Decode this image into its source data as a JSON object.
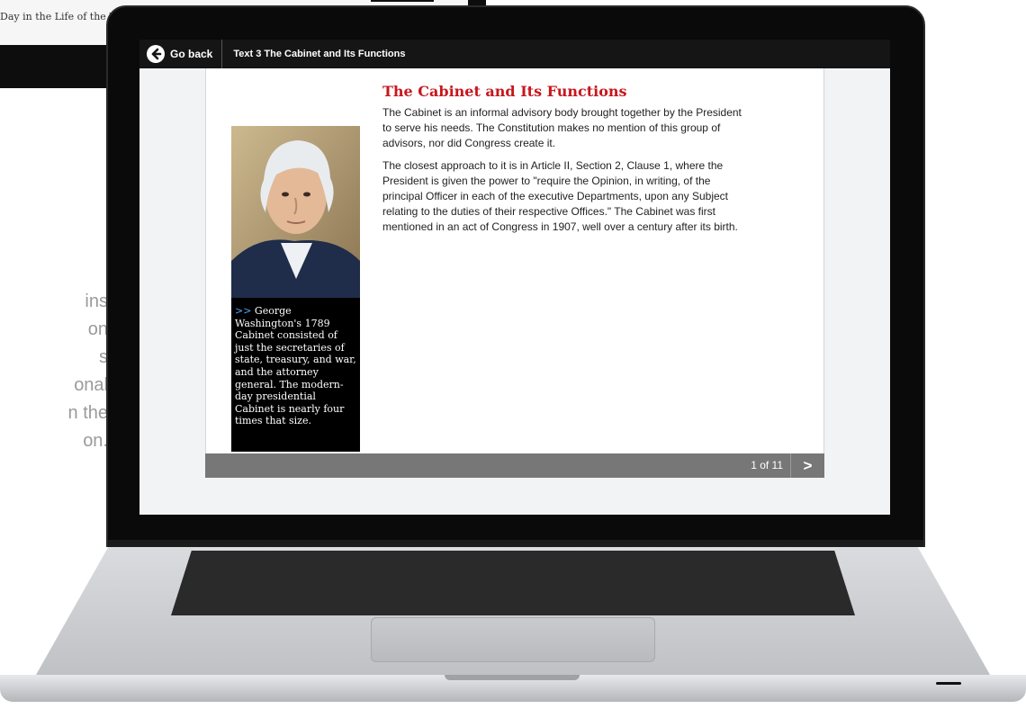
{
  "background": {
    "device_title": "Day in the Life of the W",
    "side_text_lines": [
      "ins",
      "on",
      "s",
      "onal",
      "n the",
      "on."
    ]
  },
  "app": {
    "go_back_label": "Go back",
    "title": "Text 3 The Cabinet and Its Functions",
    "icons": {
      "go_back": "arrow-left-circle-icon",
      "next": "chevron-right-icon"
    }
  },
  "article": {
    "heading": "The Cabinet and Its Functions",
    "paragraphs": [
      "The Cabinet is an informal advisory body brought together by the President to serve his needs. The Constitution makes no mention of this group of advisors, nor did Congress create it.",
      "The closest approach to it is in Article II, Section 2, Clause 1, where the President is given the power to \"require the Opinion, in writing, of the principal Officer in each of the executive Departments, upon any Subject relating to the duties of their respective Offices.\" The Cabinet was first mentioned in an act of Congress in 1907, well over a century after its birth."
    ]
  },
  "caption": {
    "marker": ">>",
    "text": " George Washington's 1789 Cabinet consisted of just the secretaries of state, treasury, and war, and the attorney general. The modern-day presidential Cabinet is nearly four times that size."
  },
  "pagination": {
    "page_label": "1 of 11",
    "next_label": ">"
  },
  "colors": {
    "heading_red": "#c8161d",
    "app_bar": "#151515",
    "page_bar": "#777777",
    "caption_marker": "#5aa9ff"
  }
}
